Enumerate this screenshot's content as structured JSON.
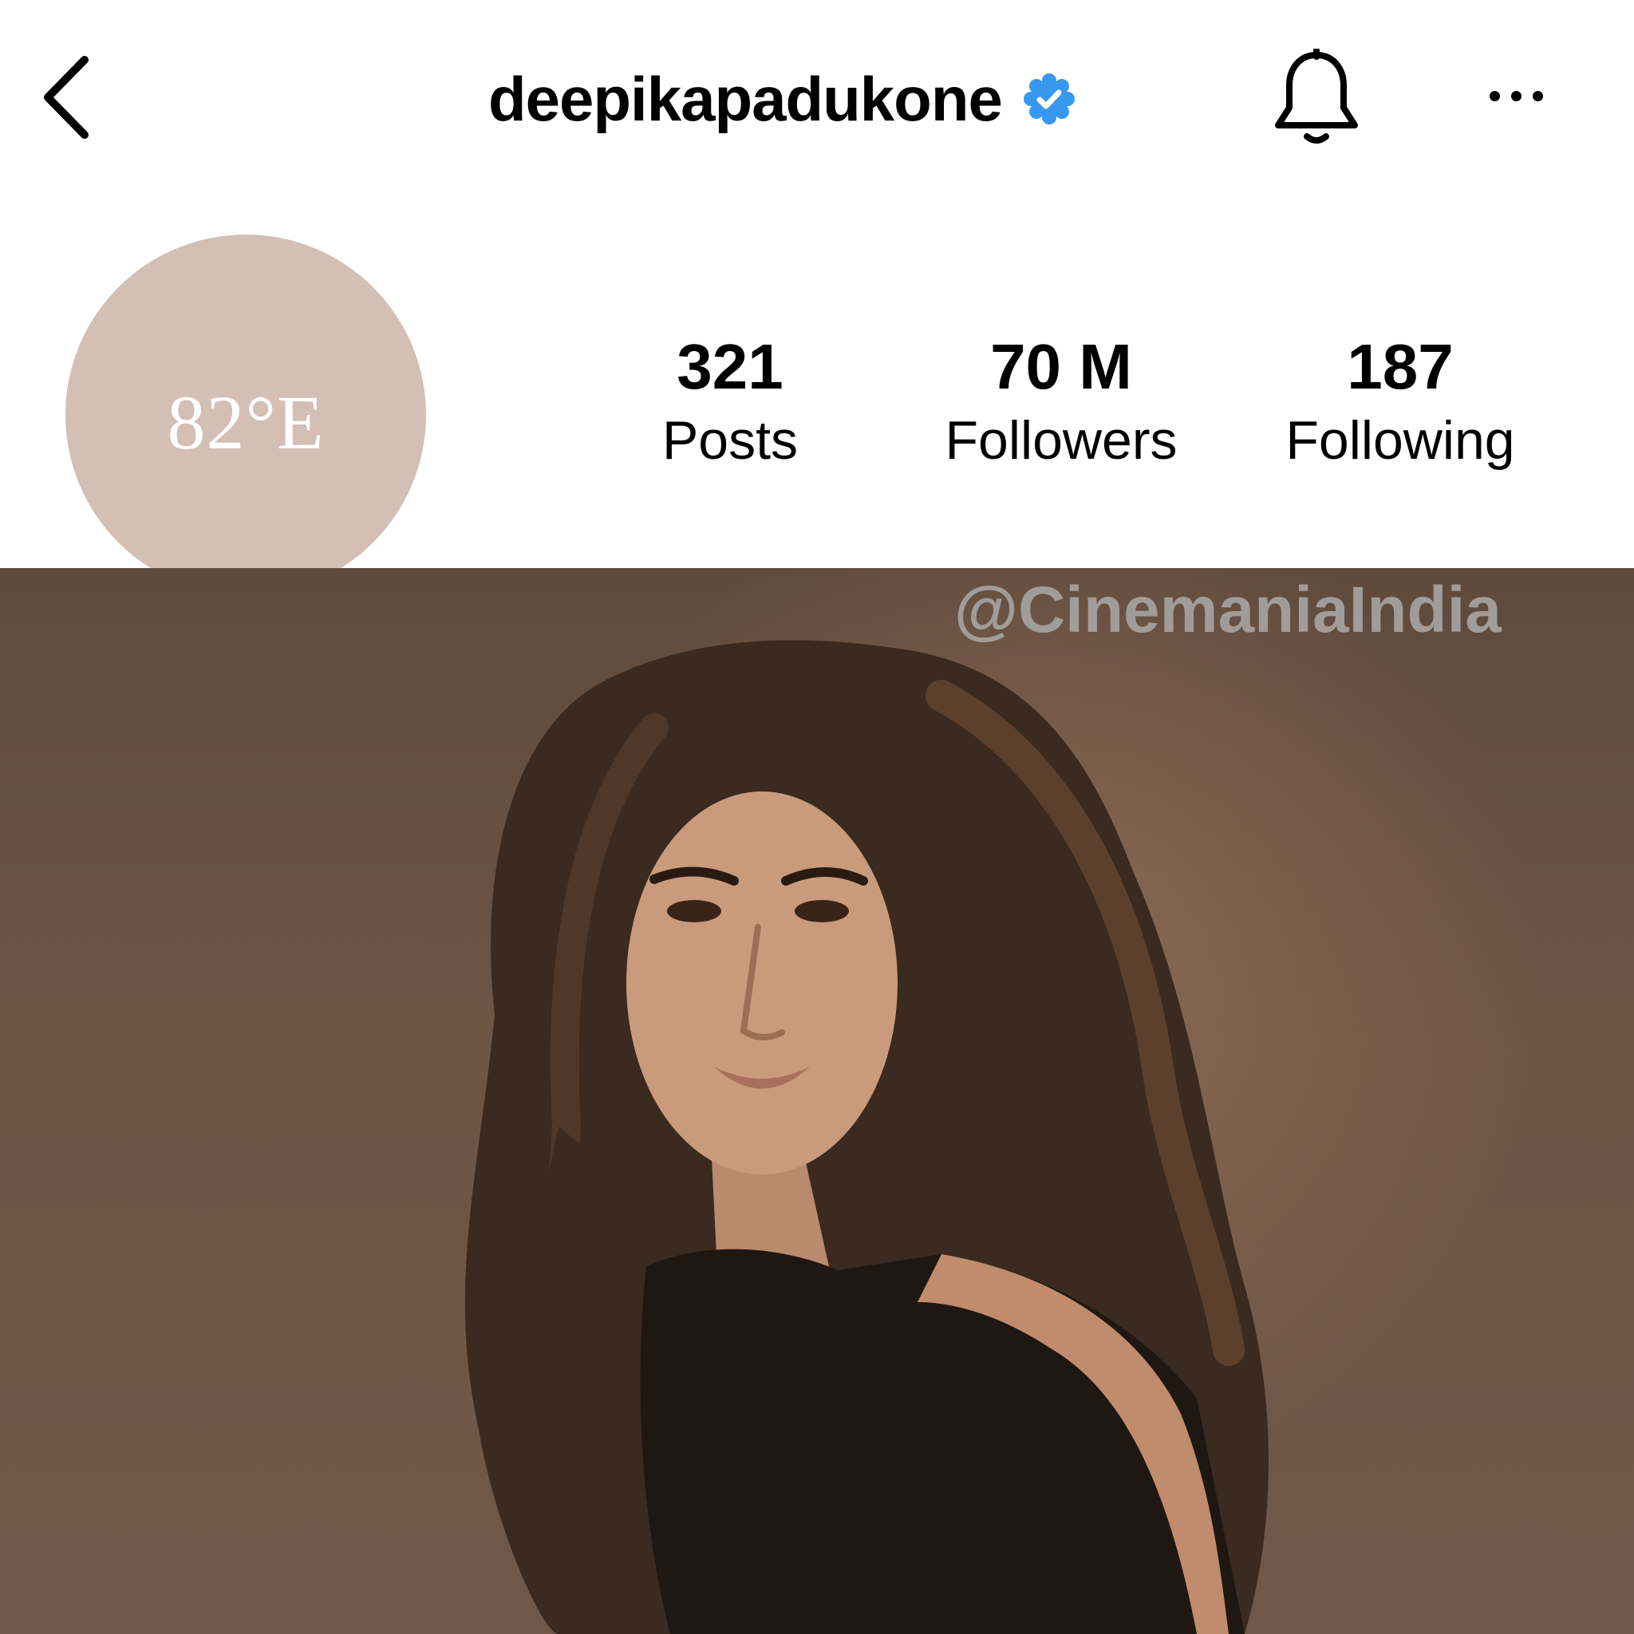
{
  "header": {
    "username": "deepikapadukone",
    "icons": {
      "back": "chevron-left-icon",
      "verified": "verified-badge-icon",
      "notifications": "bell-icon",
      "more": "more-horizontal-icon"
    }
  },
  "profile": {
    "avatar_logo": "82°E",
    "stats": [
      {
        "value": "321",
        "label": "Posts"
      },
      {
        "value": "70 M",
        "label": "Followers"
      },
      {
        "value": "187",
        "label": "Following"
      }
    ]
  },
  "photo": {
    "watermark": "@CinemaniaIndia"
  },
  "colors": {
    "verified_blue": "#3897f0",
    "avatar_bg": "#d3bfb3",
    "photo_bg": "#6e5645",
    "watermark": "#a7a5a3"
  }
}
